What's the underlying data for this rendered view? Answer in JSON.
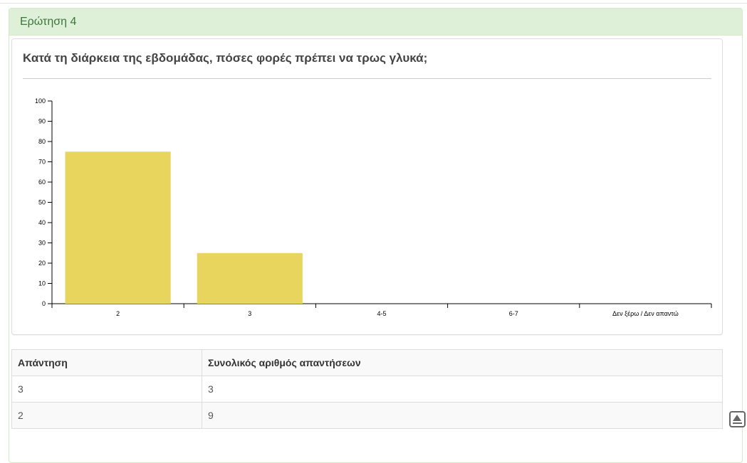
{
  "panel": {
    "heading": "Ερώτηση 4",
    "accent": "#dff0d8",
    "heading_color": "#3c763d"
  },
  "chart_data": {
    "type": "bar",
    "title": "Κατά τη διάρκεια της εβδομάδας, πόσες φορές πρέπει να τρως γλυκά;",
    "categories": [
      "2",
      "3",
      "4-5",
      "6-7",
      "Δεν ξέρω / Δεν απαντώ"
    ],
    "values": [
      75,
      25,
      0,
      0,
      0
    ],
    "yticks": [
      0,
      10,
      20,
      30,
      40,
      50,
      60,
      70,
      80,
      90,
      100
    ],
    "ylim": [
      0,
      100
    ],
    "xlabel": "",
    "ylabel": "",
    "bar_color": "#e8d55e",
    "grid": false
  },
  "table": {
    "headers": [
      "Απάντηση",
      "Συνολικός αριθμός απαντήσεων"
    ],
    "rows": [
      [
        "3",
        "3"
      ],
      [
        "2",
        "9"
      ]
    ]
  },
  "scroll_top": {
    "icon": "scroll-to-top-icon"
  }
}
